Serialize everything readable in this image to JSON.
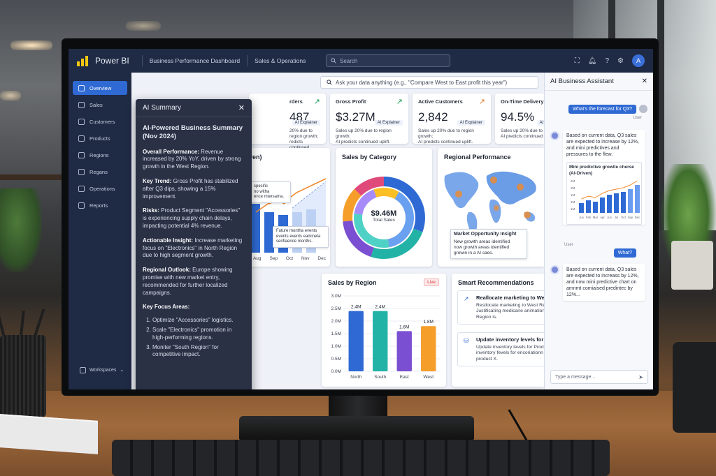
{
  "app": {
    "name": "Power BI"
  },
  "topbar": {
    "breadcrumbs": [
      "Business Performance Dashboard",
      "Sales & Operations"
    ],
    "search_placeholder": "Search",
    "avatar_initial": "A"
  },
  "sidebar": {
    "items": [
      {
        "label": "Overview",
        "active": true
      },
      {
        "label": "Sales"
      },
      {
        "label": "Customers"
      },
      {
        "label": "Products"
      },
      {
        "label": "Regions"
      },
      {
        "label": "Regans"
      },
      {
        "label": "Operations"
      },
      {
        "label": "Reports"
      }
    ],
    "workspaces_label": "Workspaces"
  },
  "ask_bar": {
    "placeholder": "Ask your data anything (e.g., \"Compare West to East profit this year\")"
  },
  "kpis": [
    {
      "label": "rders",
      "value": "487",
      "note": "20% due to region growth;\nredicts continued uplift."
    },
    {
      "label": "Gross Profit",
      "value": "$3.27M",
      "badge": "AI Explainer",
      "note": "Sales up 20% due to region growth;\nAI predicts continued uplift."
    },
    {
      "label": "Active Customers",
      "value": "2,842",
      "badge": "AI Explainer",
      "note": "Sales up 20% due to region growth;\nAI predicts continued uplift."
    },
    {
      "label": "On-Time Delivery",
      "value": "94.5%",
      "badge": "AI Explainer",
      "note": "Sales up 20% due to region growth;\nAI predicts continued uplift."
    }
  ],
  "ai_summary": {
    "panel_title": "AI Summary",
    "title": "AI-Powered Business Summary (Nov 2024)",
    "sections": [
      {
        "head": "Overall Performance:",
        "text": " Revenue increased by 20% YoY, driven by strong growth in the West Region."
      },
      {
        "head": "Key Trend:",
        "text": " Gross Profit has stabilized after Q3 dips, showing a 15% improvement."
      },
      {
        "head": "Risks:",
        "text": " Product Segment \"Accessories\" is experiencing supply chain delays, impacting potential 4% revenue."
      },
      {
        "head": "Actionable Insight:",
        "text": " Increase marketing focus on \"Electronics\" in North Region due to high segment growth."
      },
      {
        "head": "Regional Outlook:",
        "text": " Europe showing promise with new market entry, recommended for further localized campaigns."
      }
    ],
    "focus_head": "Key Focus Areas:",
    "focus_items": [
      "Optimize \"Accessories\" logistics.",
      "Scale \"Electronics\" promotion in high-performing regions.",
      "Moniter \"South Region\" for competitive impact."
    ]
  },
  "forecast_card": {
    "title": "riven)",
    "tooltip_a": "specific\nno witha\nence mtersama.",
    "tooltip_b": "Future montha events\nevents events eamineta\nsenfiaence months.",
    "months": [
      "Aug",
      "Sep",
      "Oct",
      "Nov",
      "Dec"
    ]
  },
  "category_card": {
    "title": "Sales by Category",
    "center_value": "$9.46M",
    "center_label": "Total Sales"
  },
  "regional_card": {
    "title": "Regional Performance",
    "insight_title": "Market Opportunity Insight",
    "insight_text": "New growth areas identified\nnow growth areas identified\ngrowin in a AI saes."
  },
  "chart_data": {
    "type": "bar",
    "title": "Sales by Region",
    "categories": [
      "North",
      "South",
      "East",
      "West"
    ],
    "values": [
      2.4,
      2.4,
      1.6,
      1.8
    ],
    "data_labels": [
      "2.4M",
      "2.4M",
      "1.6M",
      "1.8M"
    ],
    "y_ticks": [
      "3.0M",
      "2.5M",
      "2.0M",
      "1.5M",
      "1.0M",
      "0.5M",
      "0.0M"
    ],
    "ylim": [
      0,
      3.0
    ],
    "colors": [
      "#2f6ad4",
      "#22b3a6",
      "#7b4fd1",
      "#f59e2a"
    ],
    "live_badge": "Live"
  },
  "recommendations": {
    "title": "Smart Recommendations",
    "items": [
      {
        "title": "Reallocate marketing to West Region",
        "text": "Resllocate marketing to West Region.\nJustificating medicane animations to West\nRegion is."
      },
      {
        "title": "Update inventory levels for Product X",
        "text": "Update inventory levels for Product X, uolate\ninventory fevels for encoriationn contencer for\nproduct X."
      }
    ]
  },
  "assistant": {
    "title": "AI Business Assistant",
    "msg1_user": "What's the forecast for Q3?",
    "user_label": "User",
    "msg1_bot": "Based on current data, Q3 sales are expected to increase by 12%, and mini predictives and pressures to the flew.",
    "mini_chart_title": "Mini predictive growlle cherse (AI-Driven)",
    "mini_chart_y": [
      "2M",
      "2M",
      "1M",
      "1M",
      "1M"
    ],
    "mini_chart_x": [
      "Jun",
      "Feb",
      "Mar",
      "Apr",
      "Jun",
      "Jul",
      "Oct",
      "Sep",
      "Dec"
    ],
    "msg2_user": "What?",
    "msg2_bot": "Based on current data, Q3 sales are expected to increass by 12%, and now mini predictive chart on amnmt comiaised predintec by 12%...",
    "input_placeholder": "Type a message..."
  },
  "colors": {
    "accent": "#2f6ad4",
    "nav_bg": "#1f2a44",
    "summary_bg": "#2a3145"
  }
}
